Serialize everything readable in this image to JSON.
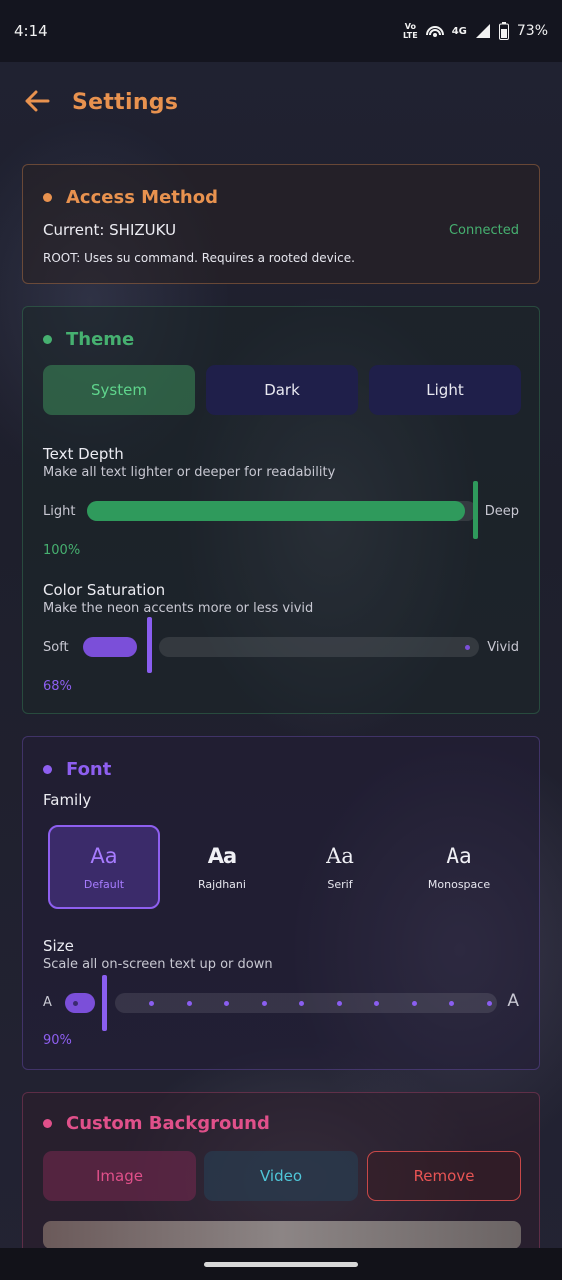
{
  "status_bar": {
    "time": "4:14",
    "network_label_top": "Vo",
    "network_label_bottom": "LTE",
    "signal_type": "4G",
    "battery": "73%",
    "icons": [
      "volte-icon",
      "hotspot-icon",
      "signal-icon",
      "battery-icon"
    ]
  },
  "header": {
    "title": "Settings",
    "back_icon": "arrow-left-icon"
  },
  "colors": {
    "orange": "#e8924f",
    "green": "#46b070",
    "purple": "#8e5ff0",
    "pink": "#e0508a"
  },
  "access": {
    "title": "Access Method",
    "current": "Current: SHIZUKU",
    "status": "Connected",
    "description": "ROOT: Uses su command. Requires a rooted device."
  },
  "theme": {
    "title": "Theme",
    "options": [
      "System",
      "Dark",
      "Light"
    ],
    "selected": "System",
    "text_depth": {
      "label": "Text Depth",
      "description": "Make all text lighter or deeper for readability",
      "min_label": "Light",
      "max_label": "Deep",
      "value_label": "100%",
      "value": 1.0
    },
    "saturation": {
      "label": "Color Saturation",
      "description": "Make the neon accents more or less vivid",
      "min_label": "Soft",
      "max_label": "Vivid",
      "value_label": "68%",
      "value": 0.68
    }
  },
  "font": {
    "title": "Font",
    "family_label": "Family",
    "families": [
      {
        "sample": "Aa",
        "name": "Default",
        "selected": true
      },
      {
        "sample": "Aa",
        "name": "Rajdhani",
        "selected": false
      },
      {
        "sample": "Aa",
        "name": "Serif",
        "selected": false
      },
      {
        "sample": "Aa",
        "name": "Monospace",
        "selected": false
      }
    ],
    "size": {
      "label": "Size",
      "description": "Scale all on-screen text up or down",
      "min_label": "A",
      "max_label": "A",
      "value_label": "90%",
      "value": 0.9
    }
  },
  "custom_background": {
    "title": "Custom Background",
    "buttons": [
      "Image",
      "Video",
      "Remove"
    ]
  }
}
